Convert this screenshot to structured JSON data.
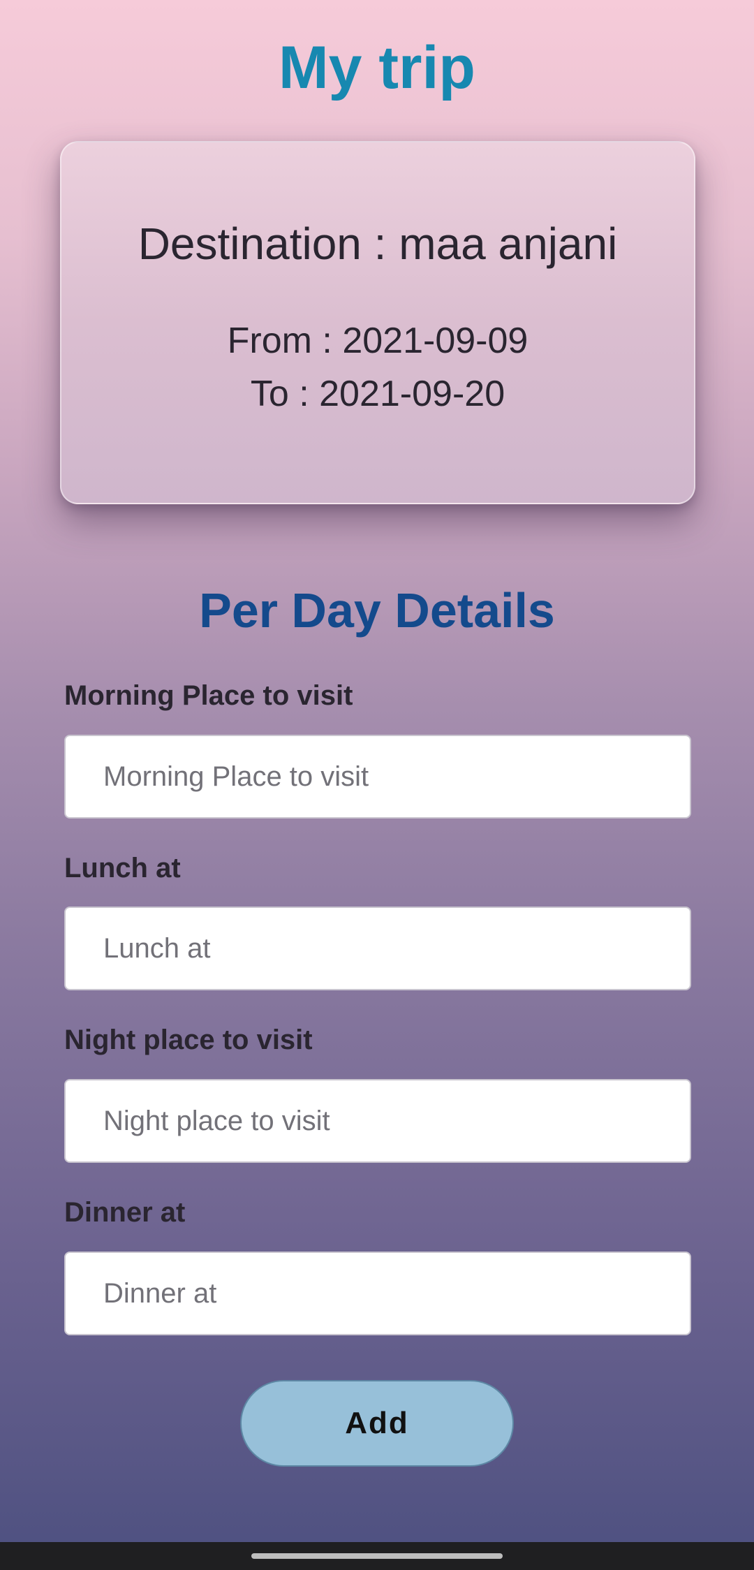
{
  "header": {
    "title": "My trip"
  },
  "trip": {
    "destination": "Destination : maa anjani",
    "from": "From : 2021-09-09",
    "to": "To : 2021-09-20"
  },
  "per_day": {
    "title": "Per Day Details",
    "fields": [
      {
        "label": "Morning Place to visit",
        "placeholder": "Morning Place to visit",
        "value": ""
      },
      {
        "label": "Lunch at",
        "placeholder": "Lunch at",
        "value": ""
      },
      {
        "label": "Night place to visit",
        "placeholder": "Night place to visit",
        "value": ""
      },
      {
        "label": "Dinner at",
        "placeholder": "Dinner at",
        "value": ""
      }
    ],
    "add_label": "Add"
  },
  "colors": {
    "title": "#1788b0",
    "section_title": "#144a8c",
    "button": "#97c0d9"
  }
}
